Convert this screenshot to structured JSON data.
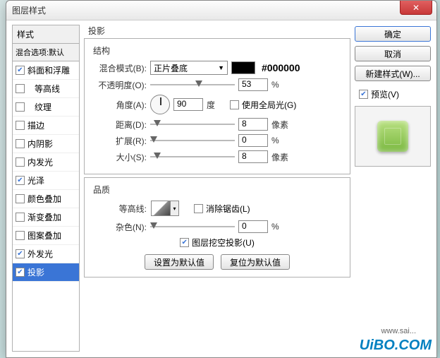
{
  "window": {
    "title": "图层样式"
  },
  "left": {
    "header": "样式",
    "blend": "混合选项:默认",
    "items": [
      {
        "label": "斜面和浮雕",
        "checked": true
      },
      {
        "label": "等高线",
        "checked": false
      },
      {
        "label": "纹理",
        "checked": false
      },
      {
        "label": "描边",
        "checked": false
      },
      {
        "label": "内阴影",
        "checked": false
      },
      {
        "label": "内发光",
        "checked": false
      },
      {
        "label": "光泽",
        "checked": true
      },
      {
        "label": "颜色叠加",
        "checked": false
      },
      {
        "label": "渐变叠加",
        "checked": false
      },
      {
        "label": "图案叠加",
        "checked": false
      },
      {
        "label": "外发光",
        "checked": true
      },
      {
        "label": "投影",
        "checked": true,
        "selected": true
      }
    ]
  },
  "mid": {
    "title": "投影",
    "structure": {
      "title": "结构",
      "blendModeLabel": "混合模式(B):",
      "blendModeValue": "正片叠底",
      "hex": "#000000",
      "opacityLabel": "不透明度(O):",
      "opacityValue": "53",
      "opacityUnit": "%",
      "angleLabel": "角度(A):",
      "angleValue": "90",
      "angleUnit": "度",
      "globalLightLabel": "使用全局光(G)",
      "distanceLabel": "距离(D):",
      "distanceValue": "8",
      "distanceUnit": "像素",
      "spreadLabel": "扩展(R):",
      "spreadValue": "0",
      "spreadUnit": "%",
      "sizeLabel": "大小(S):",
      "sizeValue": "8",
      "sizeUnit": "像素"
    },
    "quality": {
      "title": "品质",
      "contourLabel": "等高线:",
      "antiAliasLabel": "消除锯齿(L)",
      "noiseLabel": "杂色(N):",
      "noiseValue": "0",
      "noiseUnit": "%"
    },
    "knockoutLabel": "图层挖空投影(U)",
    "btnDefault": "设置为默认值",
    "btnReset": "复位为默认值"
  },
  "right": {
    "ok": "确定",
    "cancel": "取消",
    "newStyle": "新建样式(W)...",
    "previewLabel": "预览(V)"
  },
  "watermark": {
    "brand": "UiBO.COM",
    "sub": "www.sai..."
  }
}
